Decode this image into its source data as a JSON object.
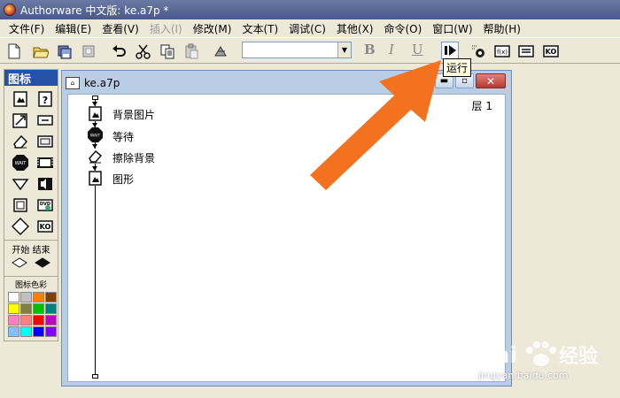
{
  "titlebar": {
    "title": "Authorware 中文版: ke.a7p *"
  },
  "menubar": [
    {
      "label": "文件(F)",
      "enabled": true
    },
    {
      "label": "编辑(E)",
      "enabled": true
    },
    {
      "label": "查看(V)",
      "enabled": true
    },
    {
      "label": "插入(I)",
      "enabled": false
    },
    {
      "label": "修改(M)",
      "enabled": true
    },
    {
      "label": "文本(T)",
      "enabled": true
    },
    {
      "label": "调试(C)",
      "enabled": true
    },
    {
      "label": "其他(X)",
      "enabled": true
    },
    {
      "label": "命令(O)",
      "enabled": true
    },
    {
      "label": "窗口(W)",
      "enabled": true
    },
    {
      "label": "帮助(H)",
      "enabled": true
    }
  ],
  "toolbar": {
    "font_value": "",
    "bold": "B",
    "italic": "I",
    "underline": "U",
    "tooltip": "运行"
  },
  "palette": {
    "title": "图标",
    "start_end_label": "开始 结束",
    "color_label": "图标色彩",
    "icons": [
      "display-icon",
      "interaction-icon",
      "motion-icon",
      "calculation-icon",
      "erase-icon",
      "map-icon",
      "wait-icon",
      "digital-movie-icon",
      "navigate-icon",
      "sound-icon",
      "framework-icon",
      "dvd-icon",
      "decision-icon",
      "knowledge-object-icon"
    ],
    "colors": [
      "#ffffff",
      "#c0c0c0",
      "#ff8000",
      "#804000",
      "#ffff00",
      "#808040",
      "#00c000",
      "#008080",
      "#ff80c0",
      "#ff8080",
      "#ff0000",
      "#c000c0",
      "#80c0ff",
      "#00ffff",
      "#0000ff",
      "#8000ff"
    ]
  },
  "design_window": {
    "title": "ke.a7p",
    "level_label": "层 1",
    "flow": [
      {
        "label": "背景图片",
        "icon": "display-icon"
      },
      {
        "label": "等待",
        "icon": "wait-icon"
      },
      {
        "label": "擦除背景",
        "icon": "erase-icon"
      },
      {
        "label": "图形",
        "icon": "display-icon"
      }
    ]
  },
  "watermark": {
    "text": "jingyan.baidu.com"
  }
}
